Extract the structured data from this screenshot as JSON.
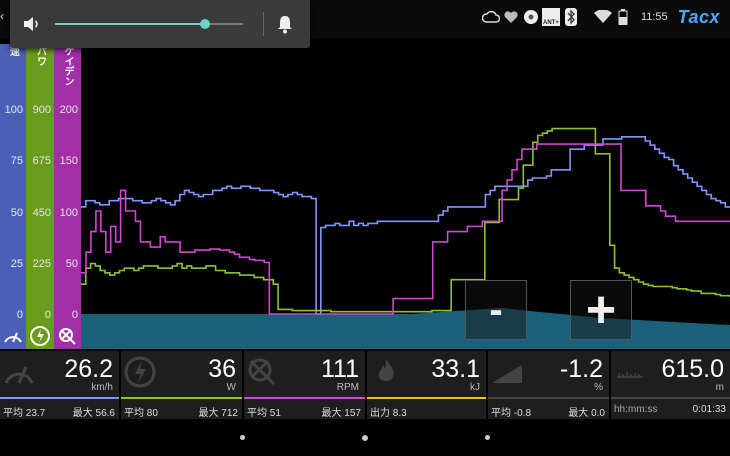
{
  "status_bar": {
    "clock": "11:55",
    "logo": "Tacx",
    "icons": [
      "cloud-upload-icon",
      "heart-icon",
      "flower-icon",
      "ant-plus-icon",
      "bluetooth-icon",
      "wifi-icon",
      "battery-icon"
    ],
    "ant_label": "ANT+"
  },
  "volume_popup": {
    "level": 0.8,
    "accent": "#6ed0c3",
    "icons": [
      "speaker-icon",
      "bell-icon"
    ]
  },
  "axes": [
    {
      "name": "速度",
      "label": "速",
      "color": "#4a5fb8",
      "ticks": [
        "100",
        "75",
        "50",
        "25",
        "0"
      ],
      "icon": "speedometer-icon"
    },
    {
      "name": "パワー",
      "label": "パワ",
      "color": "#6a9b1c",
      "ticks": [
        "900",
        "675",
        "450",
        "225",
        "0"
      ],
      "icon": "power-icon"
    },
    {
      "name": "ケイデンス",
      "label": "ケイデン",
      "color": "#a22fa8",
      "ticks": [
        "200",
        "150",
        "100",
        "50",
        "0"
      ],
      "icon": "cadence-icon"
    }
  ],
  "chart_data": {
    "type": "line",
    "series": [
      {
        "name": "速度",
        "color": "#7f96ff",
        "ymax": 100,
        "values": [
          52,
          55,
          55,
          54,
          53,
          53,
          55,
          55,
          56,
          56,
          56,
          55,
          55,
          54,
          54,
          55,
          56,
          55,
          54,
          53,
          55,
          58,
          60,
          59,
          58,
          57,
          58,
          58,
          60,
          60,
          61,
          62,
          61,
          61,
          62,
          62,
          61,
          61,
          60,
          60,
          60,
          59,
          58,
          57,
          58,
          59,
          58,
          57,
          57,
          56,
          0,
          42,
          43,
          43,
          44,
          43,
          43,
          45,
          43,
          44,
          43,
          44,
          44,
          45,
          45,
          45,
          45,
          45,
          45,
          45,
          45,
          45,
          45,
          45,
          45,
          45,
          48,
          50,
          52,
          52,
          52,
          52,
          52,
          52,
          52,
          52,
          58,
          60,
          62,
          62,
          62,
          62,
          62,
          62,
          62,
          65,
          66,
          66,
          66,
          67,
          70,
          70,
          70,
          70,
          80,
          80,
          80,
          82,
          82,
          82,
          82,
          85,
          85,
          85,
          85,
          86,
          86,
          86,
          86,
          86,
          84,
          82,
          80,
          78,
          76,
          75,
          72,
          70,
          68,
          66,
          64,
          62,
          60,
          58,
          56,
          55,
          54,
          52,
          52
        ]
      },
      {
        "name": "パワー",
        "color": "#8ec32c",
        "ymax": 900,
        "values": [
          130,
          200,
          220,
          210,
          190,
          180,
          170,
          180,
          190,
          200,
          200,
          190,
          200,
          210,
          210,
          210,
          200,
          200,
          200,
          210,
          220,
          200,
          210,
          200,
          200,
          200,
          210,
          210,
          190,
          190,
          180,
          180,
          180,
          170,
          170,
          170,
          160,
          160,
          150,
          150,
          130,
          20,
          20,
          20,
          15,
          15,
          15,
          15,
          15,
          15,
          15,
          15,
          10,
          10,
          10,
          10,
          10,
          10,
          10,
          10,
          10,
          10,
          10,
          10,
          10,
          10,
          10,
          10,
          10,
          10,
          10,
          10,
          10,
          15,
          15,
          15,
          15,
          150,
          150,
          150,
          150,
          150,
          150,
          150,
          400,
          400,
          400,
          500,
          500,
          500,
          500,
          550,
          650,
          650,
          750,
          780,
          790,
          800,
          810,
          810,
          810,
          810,
          810,
          810,
          810,
          810,
          810,
          700,
          700,
          700,
          300,
          200,
          180,
          170,
          160,
          150,
          140,
          130,
          125,
          120,
          120,
          120,
          120,
          115,
          110,
          110,
          105,
          100,
          100,
          90,
          90,
          90,
          85,
          80,
          80,
          75
        ]
      },
      {
        "name": "ケイデンス",
        "color": "#d047d3",
        "ymax": 200,
        "values": [
          40,
          60,
          80,
          100,
          80,
          60,
          85,
          70,
          120,
          100,
          100,
          90,
          70,
          70,
          65,
          65,
          75,
          70,
          70,
          70,
          60,
          60,
          60,
          62,
          62,
          62,
          63,
          63,
          62,
          62,
          60,
          58,
          55,
          55,
          53,
          52,
          52,
          50,
          0,
          0,
          0,
          0,
          0,
          0,
          0,
          0,
          0,
          0,
          0,
          0,
          0,
          0,
          0,
          0,
          0,
          0,
          0,
          0,
          0,
          0,
          0,
          0,
          0,
          15,
          15,
          15,
          15,
          15,
          15,
          15,
          15,
          70,
          70,
          70,
          80,
          80,
          80,
          80,
          85,
          85,
          85,
          90,
          90,
          90,
          90,
          120,
          130,
          140,
          150,
          160,
          160,
          160,
          165,
          165,
          165,
          165,
          165,
          165,
          165,
          165,
          165,
          165,
          165,
          165,
          165,
          165,
          165,
          165,
          165,
          120,
          120,
          120,
          120,
          120,
          105,
          105,
          105,
          100,
          95,
          95,
          90,
          90,
          90,
          90,
          90,
          90,
          90,
          90,
          90,
          90,
          90,
          90
        ]
      }
    ],
    "profile_color": "#1a6078",
    "buttons": [
      "-",
      "+"
    ]
  },
  "stats": [
    {
      "icon": "speedometer-icon",
      "value": "26.2",
      "unit": "km/h",
      "left": "平均 23.7",
      "right": "最大 56.6",
      "color": "#7f96ff"
    },
    {
      "icon": "power-icon",
      "value": "36",
      "unit": "W",
      "left": "平均 80",
      "right": "最大 712",
      "color": "#8ec32c"
    },
    {
      "icon": "cadence-icon",
      "value": "111",
      "unit": "RPM",
      "left": "平均 51",
      "right": "最大 157",
      "color": "#d047d3"
    },
    {
      "icon": "flame-icon",
      "value": "33.1",
      "unit": "kJ",
      "left": "出力 8.3",
      "right": "",
      "color": "#f0c21c"
    },
    {
      "icon": "slope-icon",
      "value": "-1.2",
      "unit": "%",
      "left": "平均 -0.8",
      "right": "最大 0.0",
      "color": "#9a9a9a"
    },
    {
      "icon": "ruler-icon",
      "value": "615.0",
      "unit": "m",
      "left": "hh:mm:ss",
      "right": "0:01:33",
      "color": "#9a9a9a"
    }
  ],
  "nav": {
    "buttons": [
      "back",
      "home",
      "recent"
    ]
  }
}
